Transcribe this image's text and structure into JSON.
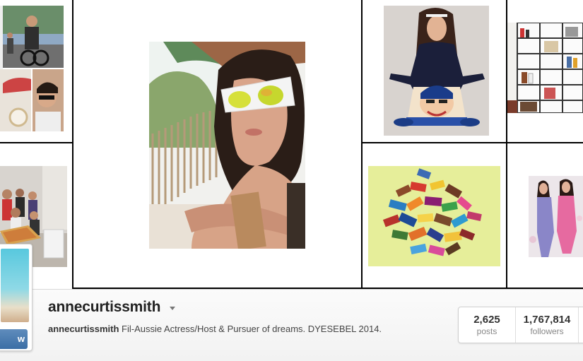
{
  "profile": {
    "username": "annecurtissmith",
    "bio_user": "annecurtissmith",
    "bio_text": "Fil-Aussie Actress/Host & Pursuer of dreams. DYESEBEL 2014.",
    "follow_button_label": "w"
  },
  "stats": {
    "posts_count": "2,625",
    "posts_label": "posts",
    "followers_count": "1,767,814",
    "followers_label": "followers"
  },
  "colors": {
    "grid_border": "#000000",
    "button_blue": "#3b6ea5",
    "header_bg": "#f4f4f4"
  },
  "icons": {
    "dropdown": "caret-down-icon"
  }
}
